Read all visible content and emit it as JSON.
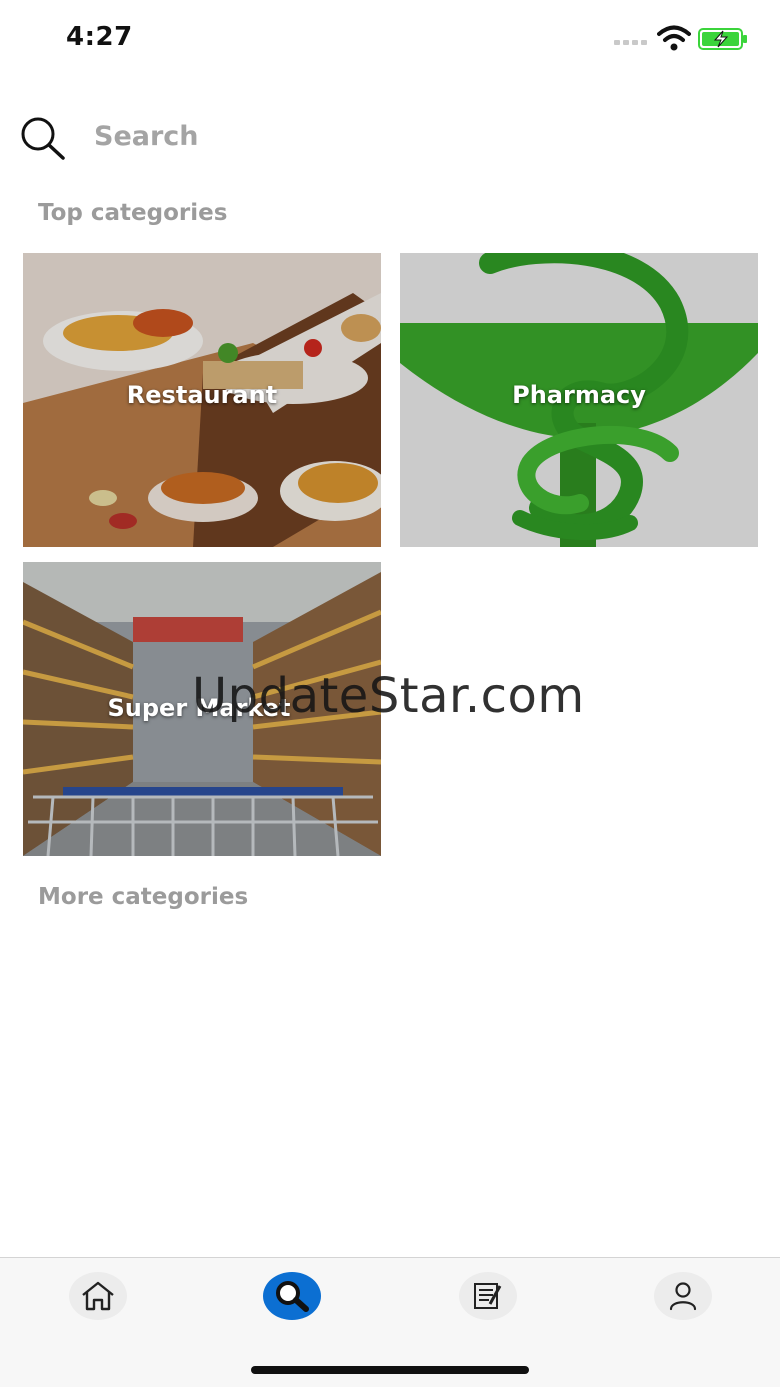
{
  "status_bar": {
    "time": "4:27",
    "battery_color": "#3bd43b"
  },
  "search": {
    "placeholder": "Search",
    "icon": "search-icon"
  },
  "sections": {
    "top_title": "Top categories",
    "more_title": "More categories"
  },
  "categories": [
    {
      "label": "Restaurant",
      "image": "food-photo"
    },
    {
      "label": "Pharmacy",
      "image": "pharmacy-symbol-photo"
    },
    {
      "label": "Super Market",
      "image": "supermarket-aisle-photo"
    }
  ],
  "watermark": "UpdateStar.com",
  "tab_bar": {
    "tabs": [
      {
        "name": "home",
        "icon": "home-icon",
        "active": false
      },
      {
        "name": "search",
        "icon": "search-icon",
        "active": true
      },
      {
        "name": "orders",
        "icon": "notepad-icon",
        "active": false
      },
      {
        "name": "profile",
        "icon": "user-icon",
        "active": false
      }
    ],
    "active_color": "#0c6fd2"
  }
}
